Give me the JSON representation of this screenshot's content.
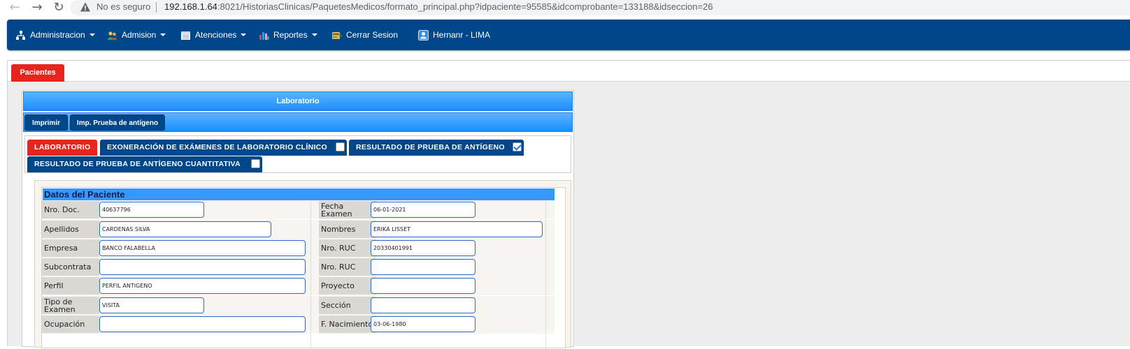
{
  "browser": {
    "security_label": "No es seguro",
    "url_host": "192.168.1.64",
    "url_rest": ":8021/HistoriasClinicas/PaquetesMedicos/formato_principal.php?idpaciente=95585&idcomprobante=133188&idseccion=26"
  },
  "nav": {
    "items": [
      {
        "label": "Administracion",
        "icon": "sitemap-icon"
      },
      {
        "label": "Admision",
        "icon": "users-icon"
      },
      {
        "label": "Atenciones",
        "icon": "calendar-icon"
      },
      {
        "label": "Reportes",
        "icon": "bar-chart-icon"
      },
      {
        "label": "Cerrar Sesion",
        "icon": "logout-icon"
      },
      {
        "label": "Hernanr  -  LIMA",
        "icon": "user-icon"
      }
    ]
  },
  "main_tab": {
    "label": "Pacientes"
  },
  "panel": {
    "title": "Laboratorio",
    "buttons": {
      "print": "Imprimir",
      "print_antigen": "Imp. Prueba de antígeno"
    }
  },
  "sub_tabs": [
    {
      "label": "LABORATORIO",
      "active": true
    },
    {
      "label": "EXONERACIÓN DE EXÁMENES DE LABORATORIO CLÍNICO",
      "checked": false
    },
    {
      "label": "RESULTADO DE PRUEBA DE ANTÍGENO",
      "checked": true
    },
    {
      "label": "RESULTADO DE PRUEBA DE ANTÍGENO CUANTITATIVA",
      "checked": false
    }
  ],
  "patient": {
    "header": "Datos del Paciente",
    "left": [
      {
        "label": "Nro. Doc.",
        "value": "40637796"
      },
      {
        "label": "Apellidos",
        "value": "CARDENAS SILVA"
      },
      {
        "label": "Empresa",
        "value": "BANCO FALABELLA"
      },
      {
        "label": "Subcontrata",
        "value": ""
      },
      {
        "label": "Perfil",
        "value": "PERFIL ANTIGENO"
      },
      {
        "label": "Tipo de Examen",
        "value": "VISITA"
      },
      {
        "label": "Ocupación",
        "value": ""
      }
    ],
    "right": [
      {
        "label": "Fecha Examen",
        "value": "06-01-2021"
      },
      {
        "label": "Nombres",
        "value": "ERIKA LISSET"
      },
      {
        "label": "Nro. RUC",
        "value": "20330401991"
      },
      {
        "label": "Nro. RUC",
        "value": ""
      },
      {
        "label": "Proyecto",
        "value": ""
      },
      {
        "label": "Sección",
        "value": ""
      },
      {
        "label": "F. Nacimiento",
        "value": "03-06-1980"
      }
    ]
  },
  "colors": {
    "nav_bg": "#00478a",
    "accent_red": "#e6251c",
    "header_blue": "#3399ff"
  }
}
